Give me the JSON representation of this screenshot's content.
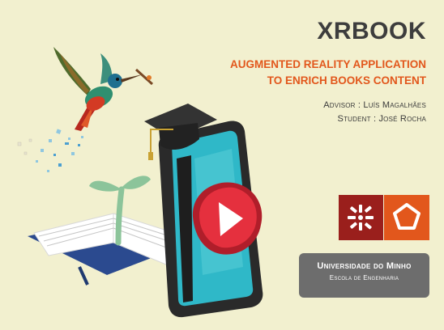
{
  "title": "XRBOOK",
  "subtitle_line1": "AUGMENTED REALITY APPLICATION",
  "subtitle_line2": "TO ENRICH BOOKS CONTENT",
  "advisor": "Advisor : Luís Magalhães",
  "student": "Student : José Rocha",
  "university": "Universidade do Minho",
  "school": "Escola de Engenharia",
  "colors": {
    "background": "#f2f0cf",
    "title": "#3d3d3d",
    "accent_orange": "#e2571c",
    "logo_red": "#9a1f1c",
    "university_box": "#6d6d6d",
    "play_button": "#e5303e",
    "phone_screen": "#2fb8c8"
  },
  "icons": [
    "hummingbird-illustration",
    "graduation-cap-icon",
    "smartphone-illustration",
    "play-button-icon",
    "open-book-illustration",
    "sprout-icon",
    "uminho-logo-icon",
    "engineering-pentagon-logo-icon"
  ]
}
